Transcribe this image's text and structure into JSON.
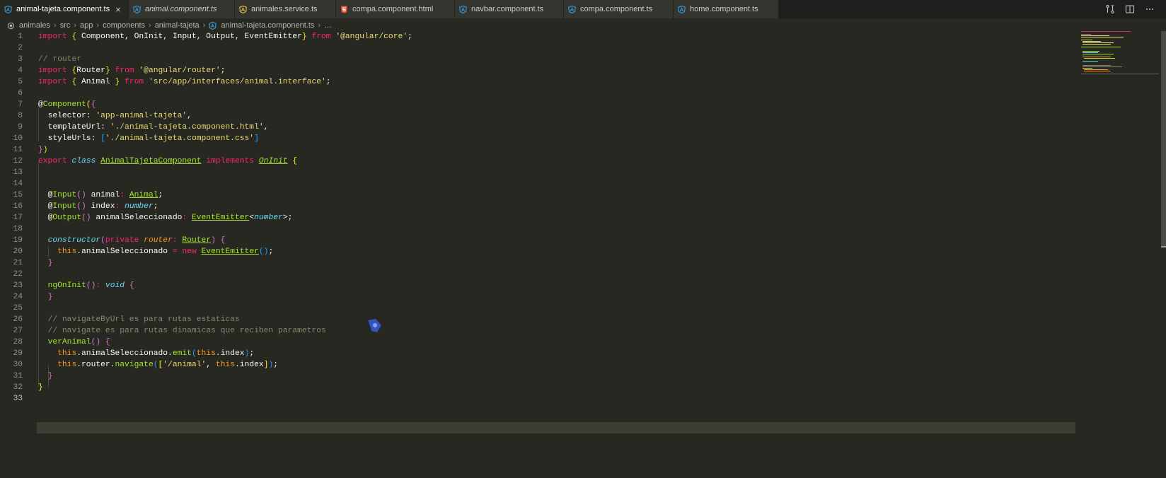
{
  "tabs": [
    {
      "label": "animal-tajeta.component.ts",
      "icon": "angular-icon",
      "active": true,
      "italic": false
    },
    {
      "label": "animal.component.ts",
      "icon": "angular-icon",
      "active": false,
      "italic": true
    },
    {
      "label": "animales.service.ts",
      "icon": "angular-service-icon",
      "active": false,
      "italic": false
    },
    {
      "label": "compa.component.html",
      "icon": "html5-icon",
      "active": false,
      "italic": false
    },
    {
      "label": "navbar.component.ts",
      "icon": "angular-icon",
      "active": false,
      "italic": false
    },
    {
      "label": "compa.component.ts",
      "icon": "angular-icon",
      "active": false,
      "italic": false
    },
    {
      "label": "home.component.ts",
      "icon": "angular-icon",
      "active": false,
      "italic": false
    }
  ],
  "tab_close_glyph": "×",
  "breadcrumb": [
    "animales",
    "src",
    "app",
    "components",
    "animal-tajeta",
    "animal-tajeta.component.ts",
    "…"
  ],
  "colors": {
    "background": "#272822",
    "keyword": "#f92672",
    "string": "#e6db74",
    "comment": "#88846f",
    "function": "#a6e22e",
    "type": "#66d9ef"
  },
  "editor": {
    "current_line": "33",
    "line_numbers": [
      "1",
      "2",
      "3",
      "4",
      "5",
      "6",
      "7",
      "8",
      "9",
      "10",
      "11",
      "12",
      "13",
      "14",
      "15",
      "16",
      "17",
      "18",
      "19",
      "20",
      "21",
      "22",
      "23",
      "24",
      "25",
      "26",
      "27",
      "28",
      "29",
      "30",
      "31",
      "32",
      "33"
    ],
    "l1": {
      "a": "import",
      "b": "{",
      "c": " Component, OnInit, Input, Output, EventEmitter",
      "d": "}",
      "e": "from",
      "f": "'@angular/core'",
      "g": ";"
    },
    "l3": "// router",
    "l4": {
      "a": "import",
      "b": "{",
      "c": "Router",
      "d": "}",
      "e": "from",
      "f": "'@angular/router'",
      "g": ";"
    },
    "l5": {
      "a": "import",
      "b": "{",
      "c": " Animal ",
      "d": "}",
      "e": "from",
      "f": "'src/app/interfaces/animal.interface'",
      "g": ";"
    },
    "l7": {
      "a": "@",
      "b": "Component",
      "c": "(",
      "d": "{"
    },
    "l8": {
      "a": "selector: ",
      "b": "'app-animal-tajeta'",
      "c": ","
    },
    "l9": {
      "a": "templateUrl: ",
      "b": "'./animal-tajeta.component.html'",
      "c": ","
    },
    "l10": {
      "a": "styleUrls: ",
      "b": "[",
      "c": "'./animal-tajeta.component.css'",
      "d": "]"
    },
    "l11": {
      "a": "}",
      "b": ")"
    },
    "l12": {
      "a": "export",
      "b": "class",
      "c": "AnimalTajetaComponent",
      "d": "implements",
      "e": "OnInit",
      "f": "{"
    },
    "l15": {
      "a": "@",
      "b": "Input",
      "c": "()",
      "d": " animal",
      "e": ":",
      "f": "Animal",
      "g": ";"
    },
    "l16": {
      "a": "@",
      "b": "Input",
      "c": "()",
      "d": " index",
      "e": ":",
      "f": "number",
      "g": ";"
    },
    "l17": {
      "a": "@",
      "b": "Output",
      "c": "()",
      "d": " animalSeleccionado",
      "e": ":",
      "f": "EventEmitter",
      "g": "<",
      "h": "number",
      "i": ">;"
    },
    "l19": {
      "a": "constructor",
      "b": "(",
      "c": "private",
      "d": "router",
      "e": ":",
      "f": "Router",
      "g": ")",
      "h": "{"
    },
    "l20": {
      "a": "this",
      "b": ".animalSeleccionado ",
      "c": "=",
      "d": "new",
      "e": "EventEmitter",
      "f": "()",
      "g": ";"
    },
    "l21": "}",
    "l23": {
      "a": "ngOnInit",
      "b": "()",
      "c": ":",
      "d": "void",
      "e": "{"
    },
    "l24": "}",
    "l26": "// navigateByUrl es para rutas estaticas",
    "l27": "// navigate es para rutas dinamicas que reciben parametros",
    "l28": {
      "a": "verAnimal",
      "b": "()",
      "c": "{"
    },
    "l29": {
      "a": "this",
      "b": ".animalSeleccionado.",
      "c": "emit",
      "d": "(",
      "e": "this",
      "f": ".index",
      "g": ")",
      "h": ";"
    },
    "l30": {
      "a": "this",
      "b": ".router.",
      "c": "navigate",
      "d": "(",
      "e": "[",
      "f": "'/animal'",
      "g": ", ",
      "h": "this",
      "i": ".index",
      "j": "]",
      "k": ")",
      "l": ";"
    },
    "l31": "}",
    "l32": "}"
  }
}
